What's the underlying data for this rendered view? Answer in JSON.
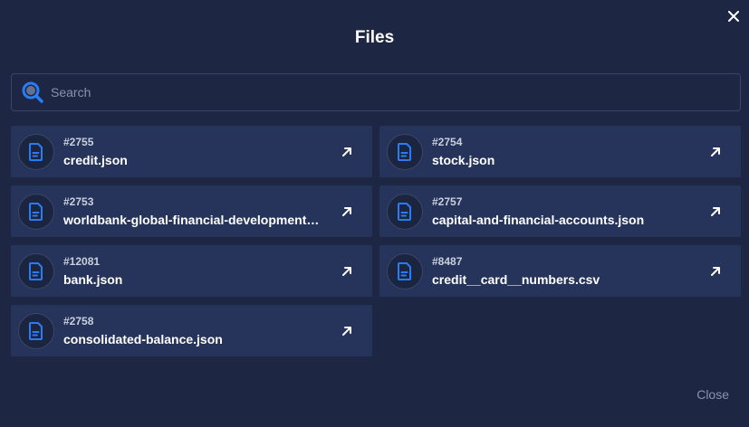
{
  "dialog": {
    "title": "Files",
    "close_icon": "close-icon",
    "close_button_label": "Close"
  },
  "search": {
    "placeholder": "Search",
    "value": "",
    "icon": "search-icon"
  },
  "colors": {
    "background": "#1d2743",
    "card": "#26345b",
    "accent": "#2a7cf6",
    "muted_text": "#8a93ad"
  },
  "files": [
    {
      "id": "#2755",
      "name": "credit.json",
      "icon": "file-icon",
      "action_icon": "open-external-icon"
    },
    {
      "id": "#2754",
      "name": "stock.json",
      "icon": "file-icon",
      "action_icon": "open-external-icon"
    },
    {
      "id": "#2753",
      "name": "worldbank-global-financial-development…",
      "icon": "file-icon",
      "action_icon": "open-external-icon"
    },
    {
      "id": "#2757",
      "name": "capital-and-financial-accounts.json",
      "icon": "file-icon",
      "action_icon": "open-external-icon"
    },
    {
      "id": "#12081",
      "name": "bank.json",
      "icon": "file-icon",
      "action_icon": "open-external-icon"
    },
    {
      "id": "#8487",
      "name": "credit__card__numbers.csv",
      "icon": "file-icon",
      "action_icon": "open-external-icon"
    },
    {
      "id": "#2758",
      "name": "consolidated-balance.json",
      "icon": "file-icon",
      "action_icon": "open-external-icon"
    }
  ]
}
